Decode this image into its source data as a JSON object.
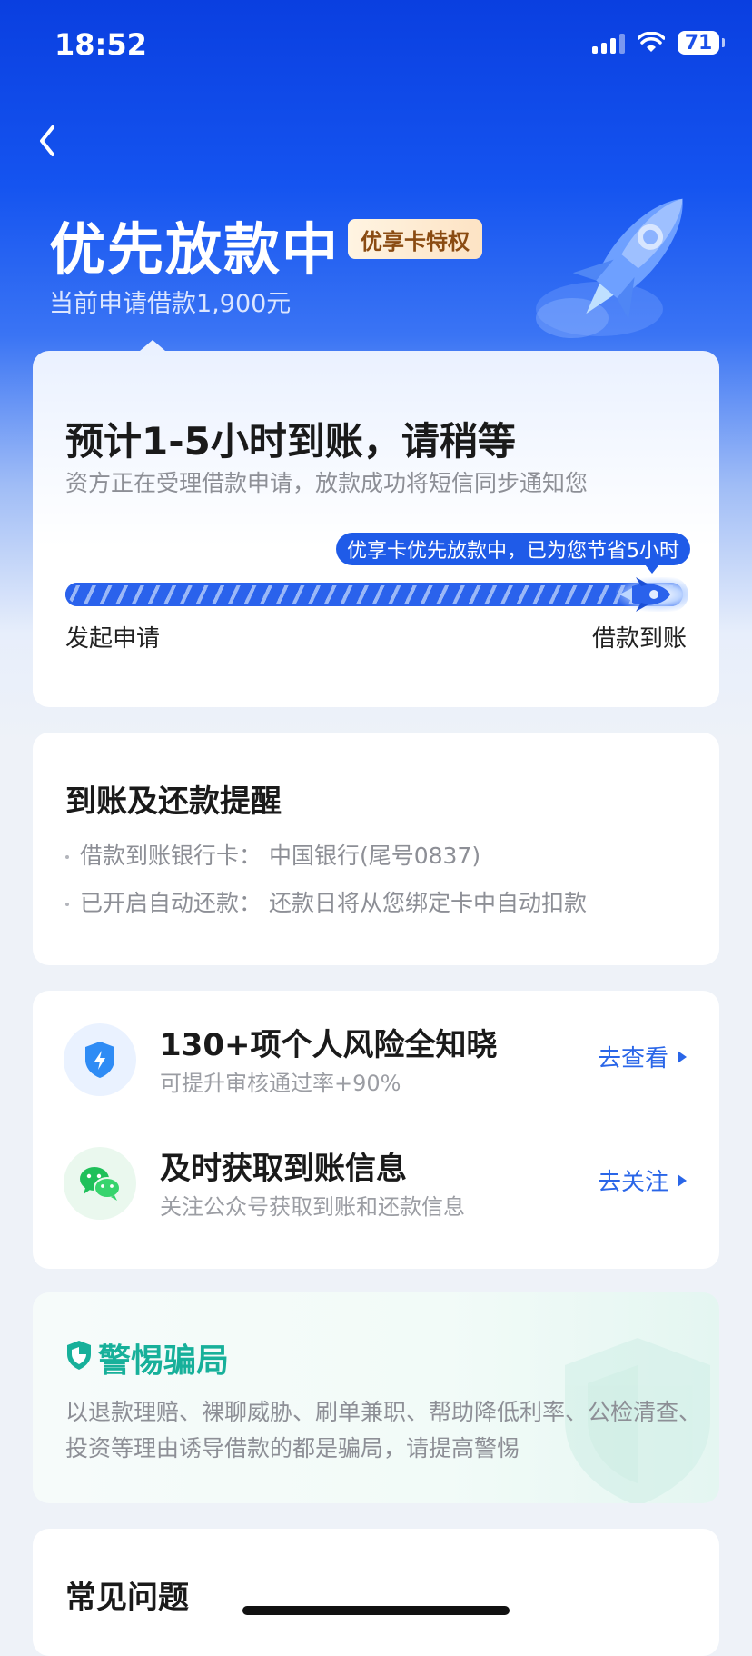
{
  "status_bar": {
    "time": "18:52",
    "battery": "71"
  },
  "header": {
    "title": "优先放款中",
    "vip_tag": "优享卡特权",
    "subtitle": "当前申请借款1,900元"
  },
  "progress_card": {
    "title": "预计1-5小时到账，请稍等",
    "description": "资方正在受理借款申请，放款成功将短信同步通知您",
    "bubble": "优享卡优先放款中，已为您节省5小时",
    "start_label": "发起申请",
    "end_label": "借款到账",
    "progress": 0.92
  },
  "reminder_card": {
    "title": "到账及还款提醒",
    "items": [
      "借款到账银行卡：  中国银行(尾号0837)",
      "已开启自动还款：  还款日将从您绑定卡中自动扣款"
    ]
  },
  "actions_card": {
    "rows": [
      {
        "title": "130+项个人风险全知晓",
        "subtitle": "可提升审核通过率+90%",
        "action": "去查看",
        "icon": "shield-lightning-icon"
      },
      {
        "title": "及时获取到账信息",
        "subtitle": "关注公众号获取到账和还款信息",
        "action": "去关注",
        "icon": "wechat-icon"
      }
    ]
  },
  "fraud_card": {
    "title": "警惕骗局",
    "text": "以退款理赔、裸聊威胁、刷单兼职、帮助降低利率、公检清查、投资等理由诱导借款的都是骗局，请提高警惕"
  },
  "faq_card": {
    "title": "常见问题"
  },
  "colors": {
    "primary": "#1f5be8",
    "accent_green": "#17b09a",
    "vip_text": "#8a4b12"
  }
}
